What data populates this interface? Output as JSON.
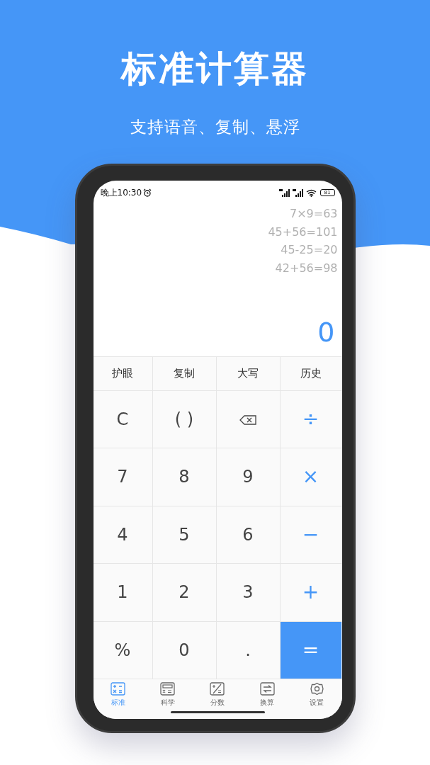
{
  "headline": "标准计算器",
  "subtitle": "支持语音、复制、悬浮",
  "status_bar": {
    "time": "晚上10:30",
    "battery": "81"
  },
  "history": [
    "7×9=63",
    "45+56=101",
    "45-25=20",
    "42+56=98"
  ],
  "display": "0",
  "functions": [
    "护眼",
    "复制",
    "大写",
    "历史"
  ],
  "keys": [
    {
      "label": "C",
      "kind": "plain"
    },
    {
      "label": "( )",
      "kind": "plain"
    },
    {
      "kind": "backspace"
    },
    {
      "label": "÷",
      "kind": "op"
    },
    {
      "label": "7",
      "kind": "plain"
    },
    {
      "label": "8",
      "kind": "plain"
    },
    {
      "label": "9",
      "kind": "plain"
    },
    {
      "label": "×",
      "kind": "op"
    },
    {
      "label": "4",
      "kind": "plain"
    },
    {
      "label": "5",
      "kind": "plain"
    },
    {
      "label": "6",
      "kind": "plain"
    },
    {
      "label": "−",
      "kind": "op"
    },
    {
      "label": "1",
      "kind": "plain"
    },
    {
      "label": "2",
      "kind": "plain"
    },
    {
      "label": "3",
      "kind": "plain"
    },
    {
      "label": "+",
      "kind": "op"
    },
    {
      "label": "%",
      "kind": "plain"
    },
    {
      "label": "0",
      "kind": "plain"
    },
    {
      "label": ".",
      "kind": "plain"
    },
    {
      "label": "=",
      "kind": "equals"
    }
  ],
  "tabs": [
    {
      "label": "标准",
      "kind": "standard",
      "selected": true
    },
    {
      "label": "科学",
      "kind": "science",
      "selected": false
    },
    {
      "label": "分数",
      "kind": "fraction",
      "selected": false
    },
    {
      "label": "换算",
      "kind": "convert",
      "selected": false
    },
    {
      "label": "设置",
      "kind": "settings",
      "selected": false
    }
  ]
}
